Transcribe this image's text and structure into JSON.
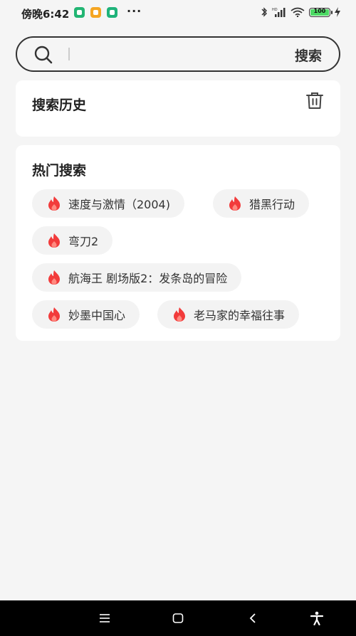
{
  "status_bar": {
    "time": "傍晚6:42",
    "more": "···",
    "battery": "100",
    "app_icons": [
      "green-app-icon",
      "orange-app-icon",
      "green-shield-icon"
    ]
  },
  "search": {
    "placeholder": "",
    "value": "",
    "button_label": "搜索"
  },
  "history": {
    "title": "搜索历史"
  },
  "hot": {
    "title": "热门搜索",
    "items": [
      "速度与激情（2004)",
      "猎黑行动",
      "弯刀2",
      "航海王 剧场版2：发条岛的冒险",
      "妙墨中国心",
      "老马家的幸福往事"
    ]
  },
  "colors": {
    "accent": "#f23b3b",
    "background": "#f5f5f5",
    "card": "#ffffff"
  }
}
